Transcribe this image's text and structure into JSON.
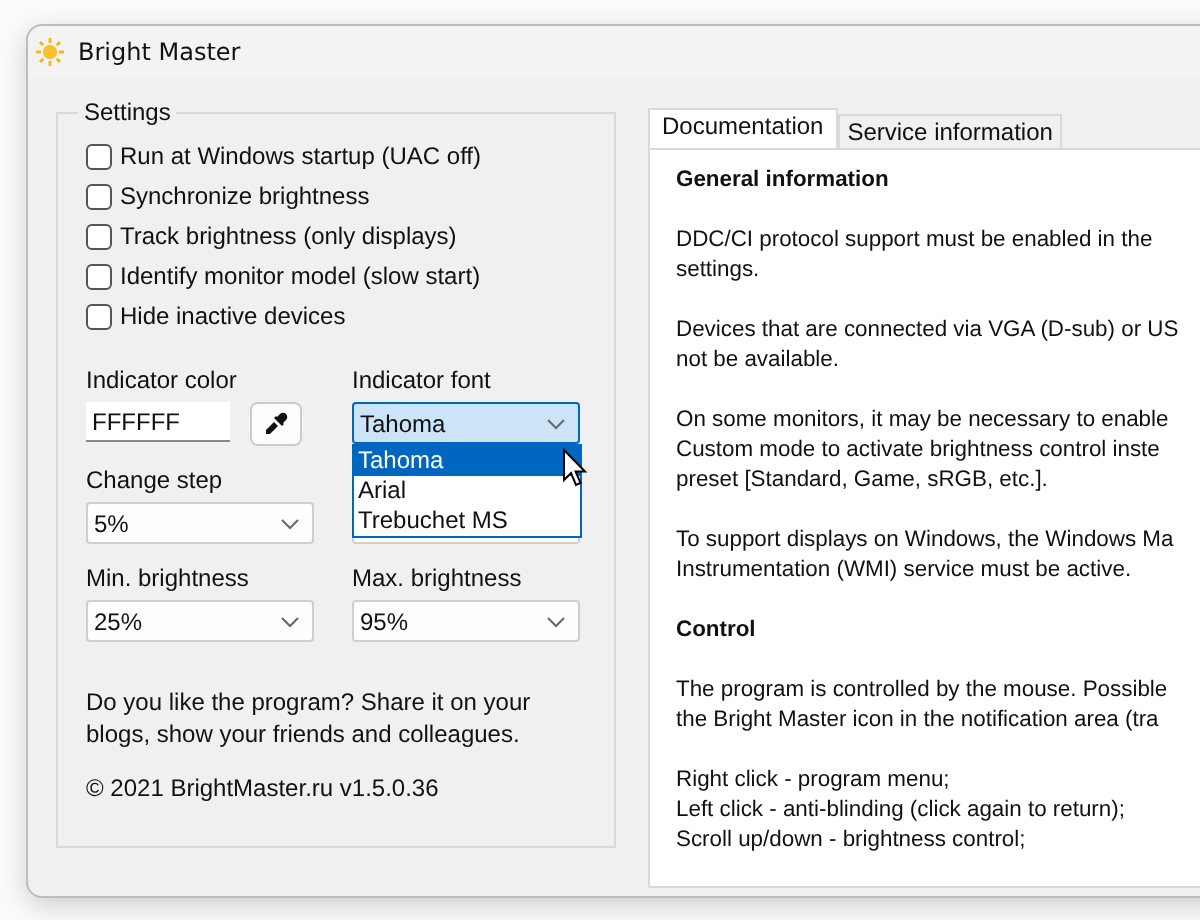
{
  "window": {
    "title": "Bright Master"
  },
  "settings": {
    "title": "Settings",
    "checkboxes": [
      {
        "label": "Run at Windows startup (UAC off)",
        "checked": false
      },
      {
        "label": "Synchronize brightness",
        "checked": false
      },
      {
        "label": "Track brightness (only displays)",
        "checked": false
      },
      {
        "label": "Identify monitor model (slow start)",
        "checked": false
      },
      {
        "label": "Hide inactive devices",
        "checked": false
      }
    ],
    "indicator_color": {
      "label": "Indicator color",
      "value": "FFFFFF"
    },
    "indicator_font": {
      "label": "Indicator font",
      "value": "Tahoma",
      "expanded": true,
      "options": [
        {
          "label": "Tahoma",
          "selected": true
        },
        {
          "label": "Arial",
          "selected": false
        },
        {
          "label": "Trebuchet MS",
          "selected": false
        }
      ]
    },
    "change_step": {
      "label": "Change step",
      "value": "5%"
    },
    "min_brightness": {
      "label": "Min. brightness",
      "value": "25%"
    },
    "max_brightness": {
      "label": "Max. brightness",
      "value": "95%"
    },
    "promo": "Do you like the program? Share it on your blogs, show your friends and colleagues.",
    "copyright": "© 2021 BrightMaster.ru v1.5.0.36"
  },
  "tabs": [
    {
      "label": "Documentation",
      "selected": true
    },
    {
      "label": "Service information",
      "selected": false
    }
  ],
  "documentation": [
    {
      "kind": "heading",
      "lines": [
        "General information"
      ]
    },
    {
      "kind": "paragraph",
      "lines": [
        "DDC/CI protocol support must be enabled in the",
        "settings."
      ]
    },
    {
      "kind": "paragraph",
      "lines": [
        "Devices that are connected via VGA (D-sub) or US",
        "not be available."
      ]
    },
    {
      "kind": "paragraph",
      "lines": [
        "On some monitors, it may be necessary to enable",
        "Custom mode to activate brightness control inste",
        "preset [Standard, Game, sRGB, etc.]."
      ]
    },
    {
      "kind": "paragraph",
      "lines": [
        "To support displays on Windows, the Windows Ma",
        "Instrumentation (WMI) service must be active."
      ]
    },
    {
      "kind": "heading",
      "lines": [
        "Control"
      ]
    },
    {
      "kind": "paragraph",
      "lines": [
        "The program is controlled by the mouse. Possible",
        "the Bright Master icon in the notification area (tra"
      ]
    },
    {
      "kind": "paragraph",
      "lines": [
        "Right click - program menu;",
        "Left click - anti-blinding (click again to return);",
        "Scroll up/down - brightness control;"
      ]
    }
  ]
}
